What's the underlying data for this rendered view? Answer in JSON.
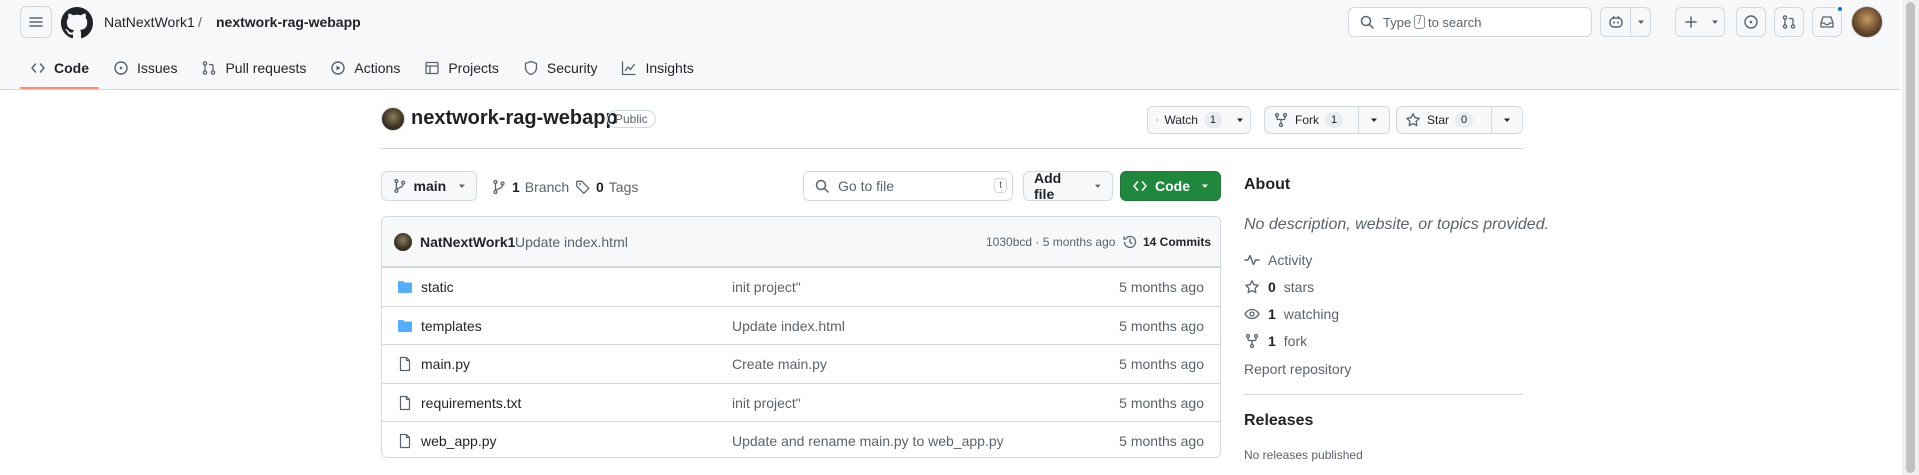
{
  "header": {
    "owner": "NatNextWork1",
    "separator": "/",
    "repo": "nextwork-rag-webapp",
    "search": {
      "prefix": "Type",
      "key": "/",
      "suffix": "to search"
    }
  },
  "tabs": [
    {
      "label": "Code",
      "icon": "code-icon",
      "active": true
    },
    {
      "label": "Issues",
      "icon": "issue-icon"
    },
    {
      "label": "Pull requests",
      "icon": "pull-request-icon"
    },
    {
      "label": "Actions",
      "icon": "play-icon"
    },
    {
      "label": "Projects",
      "icon": "table-icon"
    },
    {
      "label": "Security",
      "icon": "shield-icon"
    },
    {
      "label": "Insights",
      "icon": "graph-icon"
    }
  ],
  "repo": {
    "name": "nextwork-rag-webapp",
    "visibility": "Public",
    "watch": {
      "label": "Watch",
      "count": "1"
    },
    "fork": {
      "label": "Fork",
      "count": "1"
    },
    "star": {
      "label": "Star",
      "count": "0"
    }
  },
  "toolbar": {
    "branch": "main",
    "branches": {
      "count": "1",
      "label": "Branch"
    },
    "tags": {
      "count": "0",
      "label": "Tags"
    },
    "goto_placeholder": "Go to file",
    "goto_key": "t",
    "add_file": "Add file",
    "code": "Code"
  },
  "latest_commit": {
    "author": "NatNextWork1",
    "message": "Update index.html",
    "meta": "1030bcd · 5 months ago",
    "commits": "14 Commits"
  },
  "files": [
    {
      "name": "static",
      "type": "folder",
      "commit": "init project\"",
      "time": "5 months ago"
    },
    {
      "name": "templates",
      "type": "folder",
      "commit": "Update index.html",
      "time": "5 months ago"
    },
    {
      "name": "main.py",
      "type": "file",
      "commit": "Create main.py",
      "time": "5 months ago"
    },
    {
      "name": "requirements.txt",
      "type": "file",
      "commit": "init project\"",
      "time": "5 months ago"
    },
    {
      "name": "web_app.py",
      "type": "file",
      "commit": "Update and rename main.py to web_app.py",
      "time": "5 months ago"
    }
  ],
  "about": {
    "title": "About",
    "description": "No description, website, or topics provided.",
    "activity": "Activity",
    "stars": {
      "count": "0",
      "label": "stars"
    },
    "watching": {
      "count": "1",
      "label": "watching"
    },
    "forks": {
      "count": "1",
      "label": "fork"
    },
    "report": "Report repository",
    "releases_title": "Releases",
    "releases_empty": "No releases published"
  },
  "colors": {
    "accent_green": "#1f883d",
    "tab_underline": "#fd8c73",
    "folder_blue": "#54aeff",
    "notification_dot": "#0969da"
  }
}
